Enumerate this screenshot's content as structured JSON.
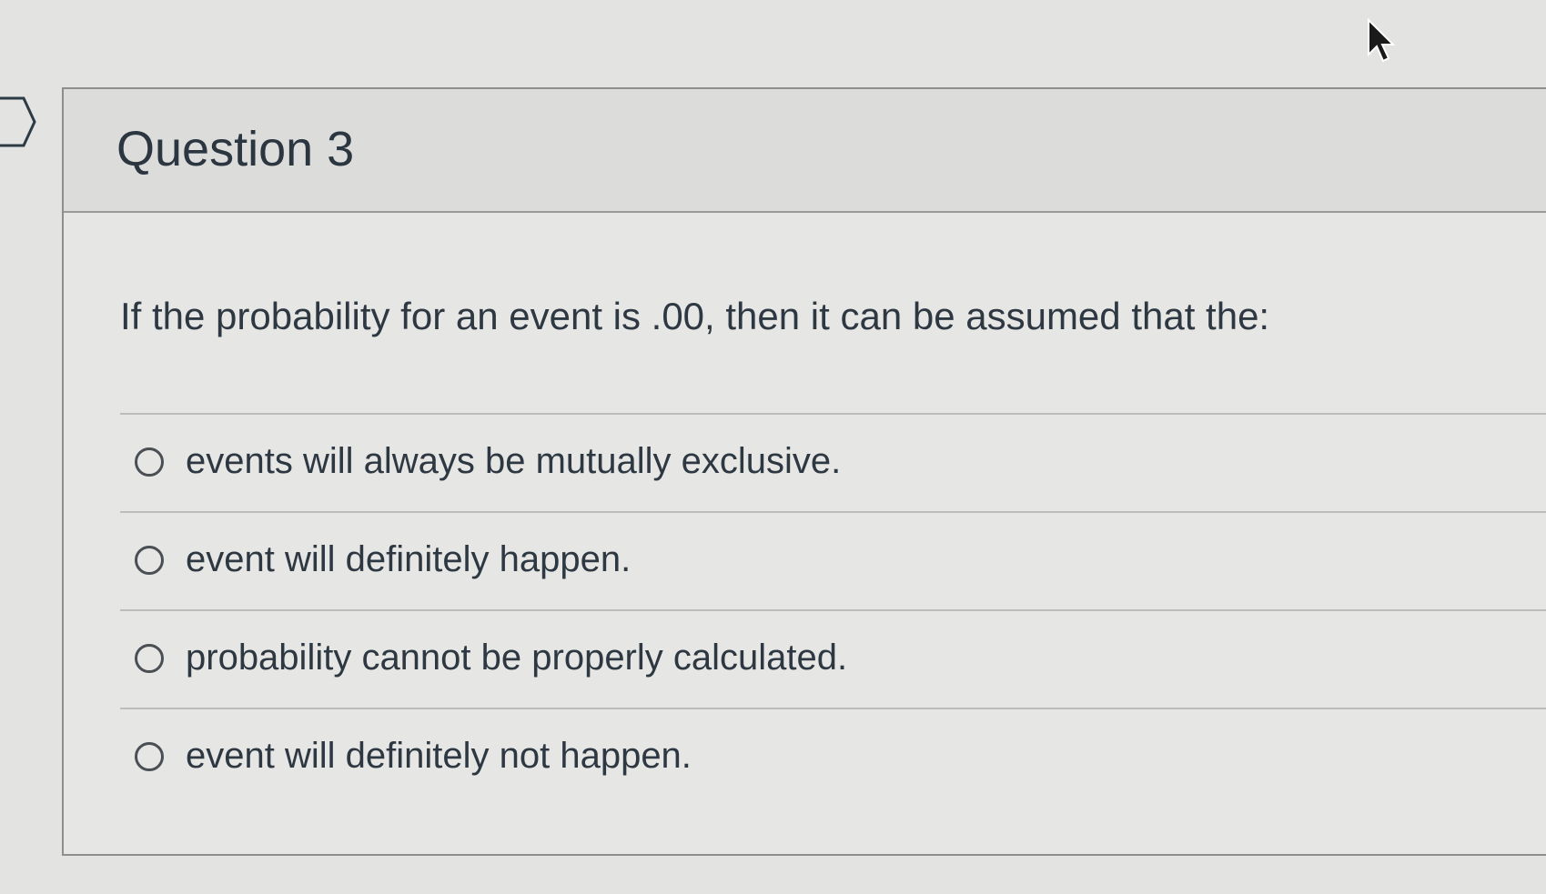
{
  "question": {
    "title": "Question 3",
    "text": "If the probability for an event is .00, then it can be assumed that the:",
    "answers": [
      {
        "label": "events will always be mutually exclusive."
      },
      {
        "label": "event will definitely happen."
      },
      {
        "label": "probability cannot be properly calculated."
      },
      {
        "label": "event will definitely not happen."
      }
    ]
  },
  "icons": {
    "flag": "flag-question-icon",
    "cursor": "mouse-pointer-icon",
    "radio": "radio-unselected-icon"
  },
  "colors": {
    "background": "#e3e3e1",
    "text": "#2e3842",
    "border": "#8e8f8d"
  }
}
